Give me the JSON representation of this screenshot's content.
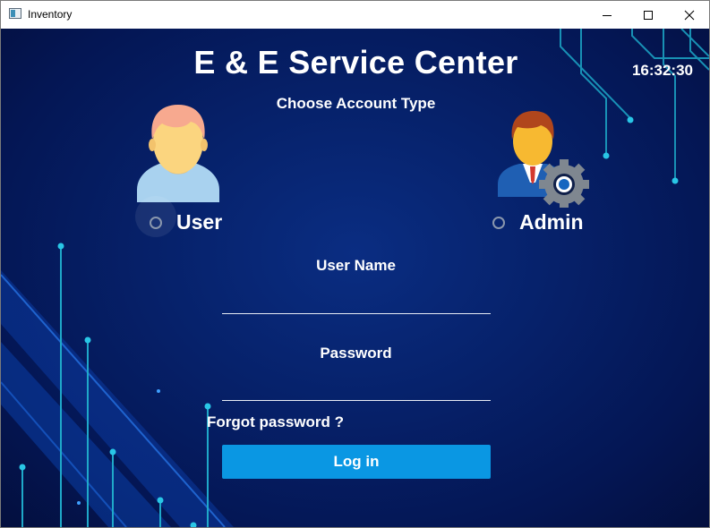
{
  "window": {
    "title": "Inventory",
    "controls": {
      "minimize_icon": "minimize-icon",
      "maximize_icon": "maximize-icon",
      "close_icon": "close-icon"
    }
  },
  "header": {
    "title": "E & E Service Center",
    "clock": "16:32:30",
    "subtitle": "Choose Account Type"
  },
  "account_types": [
    {
      "label": "User",
      "icon": "user-avatar-icon",
      "selected": false
    },
    {
      "label": "Admin",
      "icon": "admin-avatar-icon",
      "selected": false
    }
  ],
  "form": {
    "username_label": "User Name",
    "username_value": "",
    "password_label": "Password",
    "password_value": "",
    "forgot_label": "Forgot password ?",
    "login_label": "Log in"
  },
  "colors": {
    "background": "#06216a",
    "circuit": "#21b5d6",
    "login_button": "#0a97e3",
    "text": "#ffffff"
  }
}
